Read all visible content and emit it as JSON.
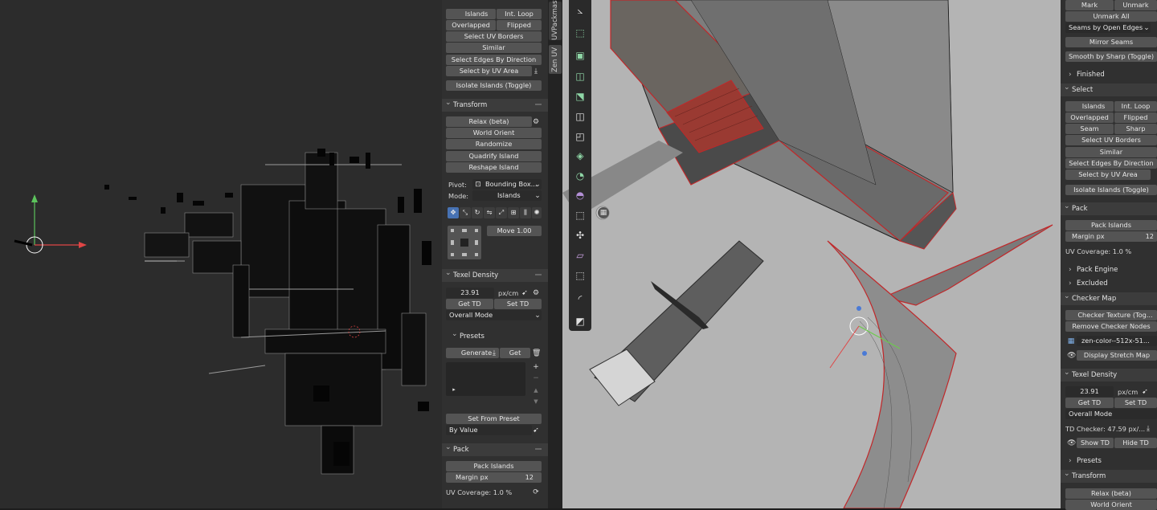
{
  "uv_panel": {
    "select": {
      "islands": "Islands",
      "int_loop": "Int. Loop",
      "overlapped": "Overlapped",
      "flipped": "Flipped",
      "select_uv_borders": "Select UV Borders",
      "similar": "Similar",
      "select_edges_by_direction": "Select Edges By Direction",
      "select_by_uv_area": "Select by UV Area",
      "isolate_islands": "Isolate Islands (Toggle)"
    },
    "transform": {
      "title": "Transform",
      "relax": "Relax (beta)",
      "world_orient": "World Orient",
      "randomize": "Randomize",
      "quadrify": "Quadrify Island",
      "reshape": "Reshape Island",
      "pivot_label": "Pivot:",
      "pivot_value": "Bounding Box...",
      "mode_label": "Mode:",
      "mode_value": "Islands",
      "move_label": "Move",
      "move_value": "1.00"
    },
    "texel_density": {
      "title": "Texel Density",
      "value": "23.91",
      "unit": "px/cm",
      "get_td": "Get TD",
      "set_td": "Set TD",
      "mode": "Overall Mode",
      "presets_title": "Presets",
      "generate": "Generate",
      "get": "Get",
      "set_from_preset": "Set From Preset",
      "by_value": "By Value"
    },
    "pack": {
      "title": "Pack",
      "pack_islands": "Pack Islands",
      "margin_label": "Margin px",
      "margin_value": "12",
      "uv_coverage": "UV Coverage: 1.0 %"
    }
  },
  "side_tabs": {
    "uvpackmaster": "UVPackmast",
    "zen_uv": "Zen UV"
  },
  "viewport_panel": {
    "seams": {
      "mark": "Mark",
      "unmark": "Unmark",
      "unmark_all": "Unmark All",
      "seams_by_open_edges": "Seams by Open Edges",
      "mirror_seams": "Mirror Seams",
      "smooth_by_sharp": "Smooth by Sharp (Toggle)",
      "finished": "Finished"
    },
    "select": {
      "title": "Select",
      "islands": "Islands",
      "int_loop": "Int. Loop",
      "overlapped": "Overlapped",
      "flipped": "Flipped",
      "seam": "Seam",
      "sharp": "Sharp",
      "select_uv_borders": "Select UV Borders",
      "similar": "Similar",
      "select_edges_by_direction": "Select Edges By Direction",
      "select_by_uv_area": "Select by UV Area",
      "isolate_islands": "Isolate Islands (Toggle)"
    },
    "pack": {
      "title": "Pack",
      "pack_islands": "Pack Islands",
      "margin_label": "Margin px",
      "margin_value": "12",
      "uv_coverage": "UV Coverage: 1.0 %",
      "pack_engine": "Pack Engine",
      "excluded": "Excluded"
    },
    "checker_map": {
      "title": "Checker Map",
      "checker_texture": "Checker Texture (Tog...",
      "remove_checker_nodes": "Remove Checker Nodes",
      "texture_name": "zen-color--512x-51...",
      "display_stretch_map": "Display Stretch Map"
    },
    "texel_density": {
      "title": "Texel Density",
      "value": "23.91",
      "unit": "px/cm",
      "get_td": "Get TD",
      "set_td": "Set TD",
      "mode": "Overall Mode",
      "td_checker": "TD Checker: 47.59 px/...",
      "show_td": "Show TD",
      "hide_td": "Hide TD",
      "presets": "Presets"
    },
    "transform": {
      "title": "Transform",
      "relax": "Relax (beta)",
      "world_orient": "World Orient"
    }
  },
  "colors": {
    "panel_bg": "#303030",
    "button": "#545454",
    "accent_blue": "#4772b3",
    "seam_red": "#c0282a"
  }
}
